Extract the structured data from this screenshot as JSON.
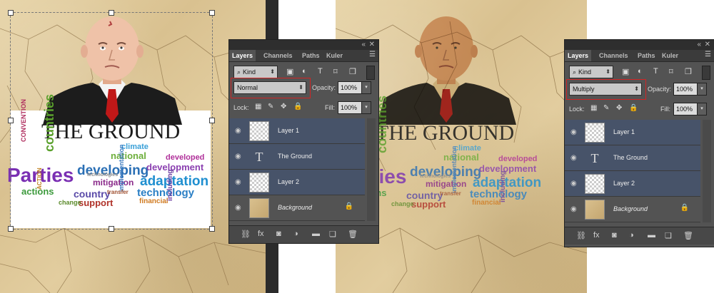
{
  "artwork": {
    "title_text": "THE GROUND",
    "words": [
      {
        "t": "Parties",
        "c": "#7a2fb3"
      },
      {
        "t": "developing",
        "c": "#2a6fb5"
      },
      {
        "t": "adaptation",
        "c": "#1f8fd0"
      },
      {
        "t": "countries",
        "c": "#5aa02c"
      },
      {
        "t": "technology",
        "c": "#2a7fc5"
      },
      {
        "t": "national",
        "c": "#6cae3a"
      },
      {
        "t": "development",
        "c": "#8a3fb0"
      },
      {
        "t": "country",
        "c": "#5a4aa8"
      },
      {
        "t": "actions",
        "c": "#3c9a3c"
      },
      {
        "t": "mitigation",
        "c": "#8a2a8a"
      },
      {
        "t": "support",
        "c": "#b0332a"
      },
      {
        "t": "climate",
        "c": "#3aa0d8"
      },
      {
        "t": "developed",
        "c": "#b0309a"
      },
      {
        "t": "implementation",
        "c": "#3a7ac0"
      },
      {
        "t": "financial",
        "c": "#d07a20"
      },
      {
        "t": "CONVENTION",
        "c": "#b03060"
      },
      {
        "t": "ACTION",
        "c": "#c08020"
      },
      {
        "t": "change",
        "c": "#5a8a2a"
      },
      {
        "t": "technologies",
        "c": "#888888"
      },
      {
        "t": "including",
        "c": "#6a3aa0"
      },
      {
        "t": "transfer",
        "c": "#a05030"
      }
    ]
  },
  "panels": [
    {
      "tabs": [
        "Layers",
        "Channels",
        "Paths",
        "Kuler"
      ],
      "active_tab": "Layers",
      "kind_label": "Kind",
      "blend_mode": "Normal",
      "opacity_label": "Opacity:",
      "opacity_value": "100%",
      "lock_label": "Lock:",
      "fill_label": "Fill:",
      "fill_value": "100%",
      "layers": [
        {
          "name": "Layer 1",
          "type": "image",
          "selected": true
        },
        {
          "name": "The Ground",
          "type": "text",
          "selected": true
        },
        {
          "name": "Layer 2",
          "type": "image",
          "selected": true
        },
        {
          "name": "Background",
          "type": "background",
          "selected": false
        }
      ]
    },
    {
      "tabs": [
        "Layers",
        "Channels",
        "Paths",
        "Kuler"
      ],
      "active_tab": "Layers",
      "kind_label": "Kind",
      "blend_mode": "Multiply",
      "opacity_label": "Opacity:",
      "opacity_value": "100%",
      "lock_label": "Lock:",
      "fill_label": "Fill:",
      "fill_value": "100%",
      "layers": [
        {
          "name": "Layer 1",
          "type": "image",
          "selected": true
        },
        {
          "name": "The Ground",
          "type": "text",
          "selected": true
        },
        {
          "name": "Layer 2",
          "type": "image",
          "selected": true
        },
        {
          "name": "Background",
          "type": "background",
          "selected": false
        }
      ]
    }
  ],
  "colors": {
    "selected_layer": "#475369",
    "panel_bg": "#535353",
    "highlight": "#d02525"
  }
}
